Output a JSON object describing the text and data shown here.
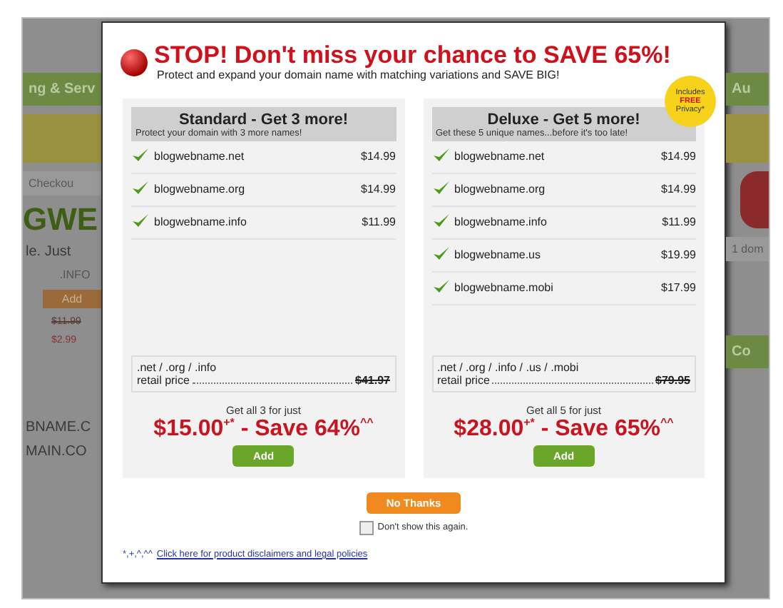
{
  "background": {
    "left": [
      {
        "kind": "bar",
        "text": "ng & Serv"
      },
      {
        "kind": "band"
      },
      {
        "kind": "small",
        "text": "Checkou"
      },
      {
        "kind": "big",
        "text": "GWE"
      },
      {
        "kind": "line",
        "text": "le. Just"
      },
      {
        "kind": "head",
        "text": ".INFO"
      },
      {
        "kind": "button",
        "text": "Add"
      },
      {
        "kind": "strike",
        "text": "$11.99"
      },
      {
        "kind": "red",
        "text": "$2.99"
      },
      {
        "kind": "gap"
      },
      {
        "kind": "line",
        "text": "BNAME.C"
      },
      {
        "kind": "line",
        "text": "MAIN.CO"
      }
    ],
    "right": [
      {
        "kind": "bar",
        "text": "Au"
      },
      {
        "kind": "band"
      },
      {
        "kind": "tag"
      },
      {
        "kind": "small",
        "text": "1 dom"
      },
      {
        "kind": "gap"
      },
      {
        "kind": "bar",
        "text": "Co"
      }
    ]
  },
  "header": {
    "title": "STOP! Don't miss your chance to SAVE 65%!",
    "subtitle": "Protect and expand your domain name with matching variations and SAVE BIG!"
  },
  "plans": [
    {
      "title": "Standard - Get 3 more!",
      "subtitle": "Protect your domain with 3 more names!",
      "items": [
        {
          "name": "blogwebname.net",
          "price": "$14.99",
          "checked": true
        },
        {
          "name": "blogwebname.org",
          "price": "$14.99",
          "checked": true
        },
        {
          "name": "blogwebname.info",
          "price": "$11.99",
          "checked": true
        }
      ],
      "retail_label": ".net / .org / .info",
      "retail_caption": "retail price",
      "retail_price": "$41.97",
      "offer": "Get all 3 for just",
      "price": "$15.00$^{+*}$ - Save 64%$^{^^}$",
      "button": "Add"
    },
    {
      "title": "Deluxe - Get 5 more!",
      "subtitle": "Get these 5 unique names...before it's too late!",
      "badge": [
        "Includes",
        "FREE",
        "Privacy*"
      ],
      "items": [
        {
          "name": "blogwebname.net",
          "price": "$14.99",
          "checked": true
        },
        {
          "name": "blogwebname.org",
          "price": "$14.99",
          "checked": true
        },
        {
          "name": "blogwebname.info",
          "price": "$11.99",
          "checked": true
        },
        {
          "name": "blogwebname.us",
          "price": "$19.99",
          "checked": true
        },
        {
          "name": "blogwebname.mobi",
          "price": "$17.99",
          "checked": true
        }
      ],
      "retail_label": ".net / .org / .info / .us / .mobi",
      "retail_caption": "retail price",
      "retail_price": "$79.95",
      "offer": "Get all 5 for just",
      "price": "$28.00$^{+*}$ - Save 65%$^{^^}$",
      "button": "Add"
    }
  ],
  "decline_button": "No Thanks",
  "dont_show": {
    "label": "Don't show this again.",
    "checked": false
  },
  "footer": {
    "marks": "*,+,^,^^",
    "link": "Click here for product disclaimers and legal policies"
  }
}
